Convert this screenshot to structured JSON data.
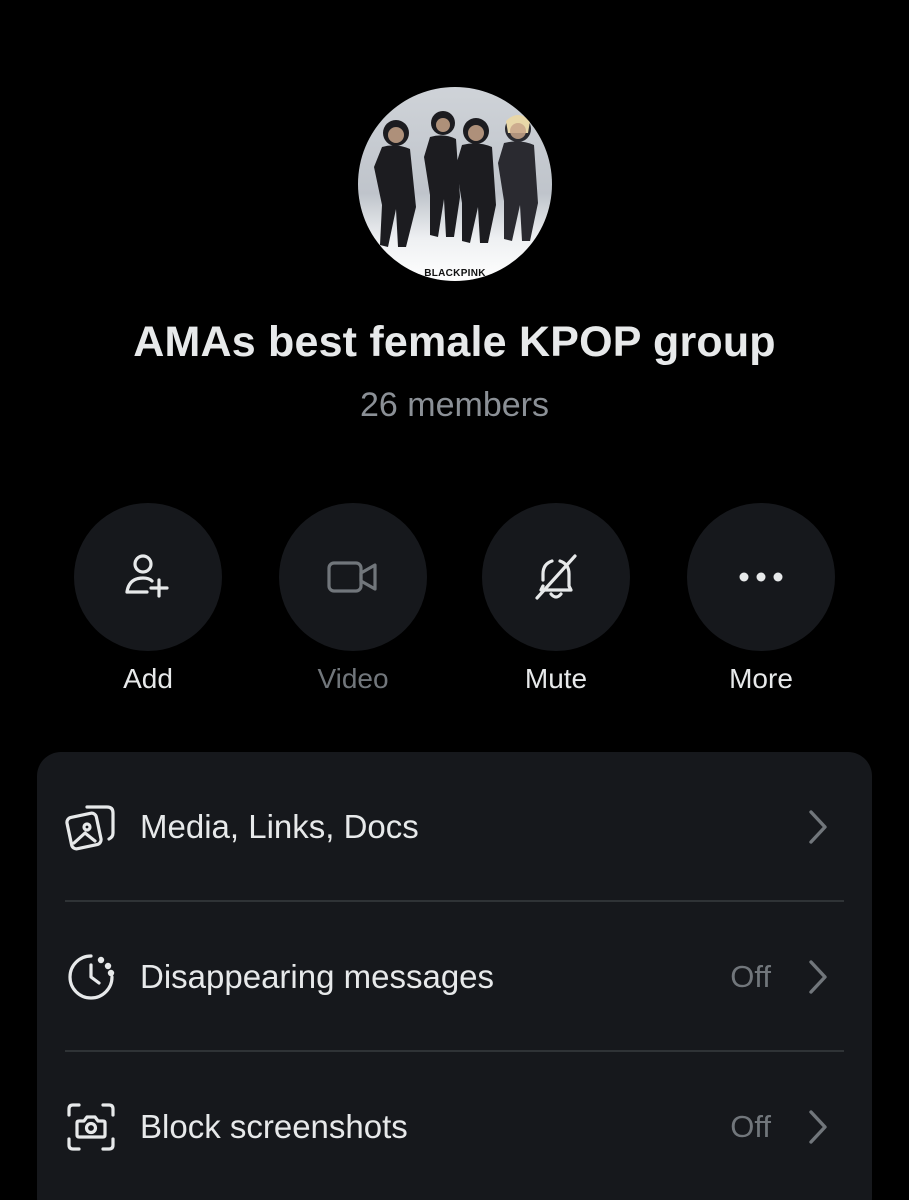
{
  "group": {
    "name": "AMAs best female KPOP group",
    "members": "26 members",
    "avatar_caption": "BLACKPINK"
  },
  "actions": [
    {
      "label": "Add",
      "icon": "add-user-icon",
      "enabled": true
    },
    {
      "label": "Video",
      "icon": "video-camera-icon",
      "enabled": false
    },
    {
      "label": "Mute",
      "icon": "bell-off-icon",
      "enabled": true
    },
    {
      "label": "More",
      "icon": "more-dots-icon",
      "enabled": true
    }
  ],
  "settings": [
    {
      "label": "Media, Links, Docs",
      "icon": "media-gallery-icon",
      "value": ""
    },
    {
      "label": "Disappearing messages",
      "icon": "timer-icon",
      "value": "Off"
    },
    {
      "label": "Block screenshots",
      "icon": "screenshot-camera-icon",
      "value": "Off"
    }
  ],
  "colors": {
    "background": "#000000",
    "surface": "#16181c",
    "text_primary": "#e7e9ea",
    "text_secondary": "#71767b",
    "divider": "#2f3336"
  }
}
